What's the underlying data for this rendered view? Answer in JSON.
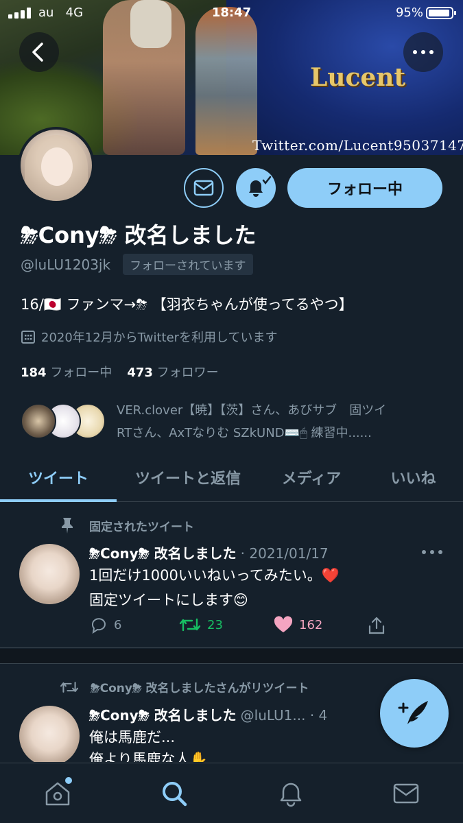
{
  "status_bar": {
    "carrier": "au",
    "network": "4G",
    "time": "18:47",
    "battery": "95%",
    "battery_level": 0.95
  },
  "banner": {
    "logo_text": "Lucent",
    "watermark": "Twitter.com/Lucent95037147"
  },
  "profile": {
    "display_name": "⛈Cony⛈ 改名しました",
    "handle": "@luLU1203jk",
    "follows_you": "フォローされています",
    "bio": "16/🇯🇵 ファンマ→⛈ 【羽衣ちゃんが使ってるやつ】",
    "joined": "2020年12月からTwitterを利用しています",
    "following_count": "184",
    "following_label": "フォロー中",
    "followers_count": "473",
    "followers_label": "フォロワー",
    "follow_button": "フォロー中",
    "followed_by_line1": "VER.clover【暁】【茨】さん、あびサブ　固ツイ",
    "followed_by_line2": "RTさん、AxTなりむ SZkUND⌨️🖱 練習中......"
  },
  "tabs": [
    "ツイート",
    "ツイートと返信",
    "メディア",
    "いいね"
  ],
  "tweets": [
    {
      "context": "固定されたツイート",
      "name": "⛈Cony⛈ 改名しました",
      "meta": "· 2021/01/17",
      "line1": "1回だけ1000いいねいってみたい。❤️",
      "line2": "固定ツイートにします😊",
      "replies": "6",
      "retweets": "23",
      "likes": "162"
    },
    {
      "context": "⛈Cony⛈ 改名しましたさんがリツイート",
      "name": "⛈Cony⛈ 改名しました",
      "meta": "@luLU1... · 4",
      "line1": "俺は馬鹿だ...",
      "line2": "俺より馬鹿な人✋"
    }
  ],
  "icons": [
    "back-arrow-icon",
    "more-dots-icon",
    "mail-icon",
    "bell-icon",
    "calendar-icon",
    "pin-icon",
    "reply-icon",
    "retweet-icon",
    "heart-icon",
    "share-icon",
    "compose-icon",
    "home-icon",
    "search-icon",
    "notifications-icon",
    "messages-icon"
  ],
  "colors": {
    "background": "#15202b",
    "accent": "#8ecdf8",
    "secondary_text": "#8899a6",
    "retweet": "#17bf63",
    "like": "#f4a5c1"
  }
}
